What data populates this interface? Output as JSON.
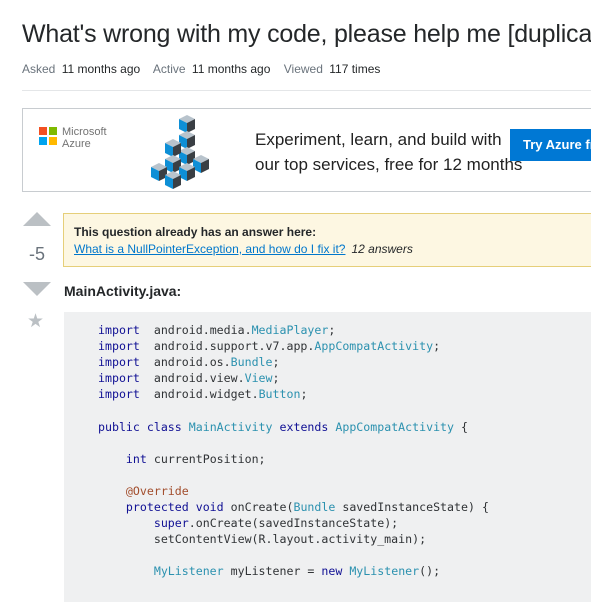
{
  "question": {
    "title": "What's wrong with my code, please help me [duplicate]",
    "asked_label": "Asked",
    "asked_value": "11 months ago",
    "active_label": "Active",
    "active_value": "11 months ago",
    "viewed_label": "Viewed",
    "viewed_value": "117 times",
    "score": "-5",
    "filename": "MainActivity.java:"
  },
  "ad": {
    "brand_line1": "Microsoft",
    "brand_line2": "Azure",
    "copy_line1": "Experiment, learn, and build with",
    "copy_line2": "our top services, free for 12 months",
    "cta": "Try Azure free",
    "logo_colors": [
      "#f25022",
      "#7fba00",
      "#00a4ef",
      "#ffb900"
    ]
  },
  "duplicate_notice": {
    "heading": "This question already has an answer here:",
    "link_text": "What is a NullPointerException, and how do I fix it?",
    "answers": "12 answers"
  },
  "code_lines": [
    [
      [
        "kw",
        "import"
      ],
      [
        "",
        "  android.media."
      ],
      [
        "ty",
        "MediaPlayer"
      ],
      [
        "",
        ";"
      ]
    ],
    [
      [
        "kw",
        "import"
      ],
      [
        "",
        "  android.support.v7.app."
      ],
      [
        "ty",
        "AppCompatActivity"
      ],
      [
        "",
        ";"
      ]
    ],
    [
      [
        "kw",
        "import"
      ],
      [
        "",
        "  android.os."
      ],
      [
        "ty",
        "Bundle"
      ],
      [
        "",
        ";"
      ]
    ],
    [
      [
        "kw",
        "import"
      ],
      [
        "",
        "  android.view."
      ],
      [
        "ty",
        "View"
      ],
      [
        "",
        ";"
      ]
    ],
    [
      [
        "kw",
        "import"
      ],
      [
        "",
        "  android.widget."
      ],
      [
        "ty",
        "Button"
      ],
      [
        "",
        ";"
      ]
    ],
    [],
    [
      [
        "kw",
        "public class"
      ],
      [
        "",
        " "
      ],
      [
        "ty",
        "MainActivity"
      ],
      [
        "",
        " "
      ],
      [
        "kw",
        "extends"
      ],
      [
        "",
        " "
      ],
      [
        "ty",
        "AppCompatActivity"
      ],
      [
        "",
        " {"
      ]
    ],
    [],
    [
      [
        "",
        "    "
      ],
      [
        "kw",
        "int"
      ],
      [
        "",
        " currentPosition;"
      ]
    ],
    [],
    [
      [
        "",
        "    "
      ],
      [
        "an",
        "@Override"
      ]
    ],
    [
      [
        "",
        "    "
      ],
      [
        "kw",
        "protected void"
      ],
      [
        "",
        " onCreate("
      ],
      [
        "ty",
        "Bundle"
      ],
      [
        "",
        " savedInstanceState) {"
      ]
    ],
    [
      [
        "",
        "        "
      ],
      [
        "kw",
        "super"
      ],
      [
        "",
        ".onCreate(savedInstanceState);"
      ]
    ],
    [
      [
        "",
        "        setContentView(R.layout.activity_main);"
      ]
    ],
    [],
    [
      [
        "",
        "        "
      ],
      [
        "ty",
        "MyListener"
      ],
      [
        "",
        " myListener = "
      ],
      [
        "kw",
        "new"
      ],
      [
        "",
        " "
      ],
      [
        "ty",
        "MyListener"
      ],
      [
        "",
        "();"
      ]
    ]
  ]
}
